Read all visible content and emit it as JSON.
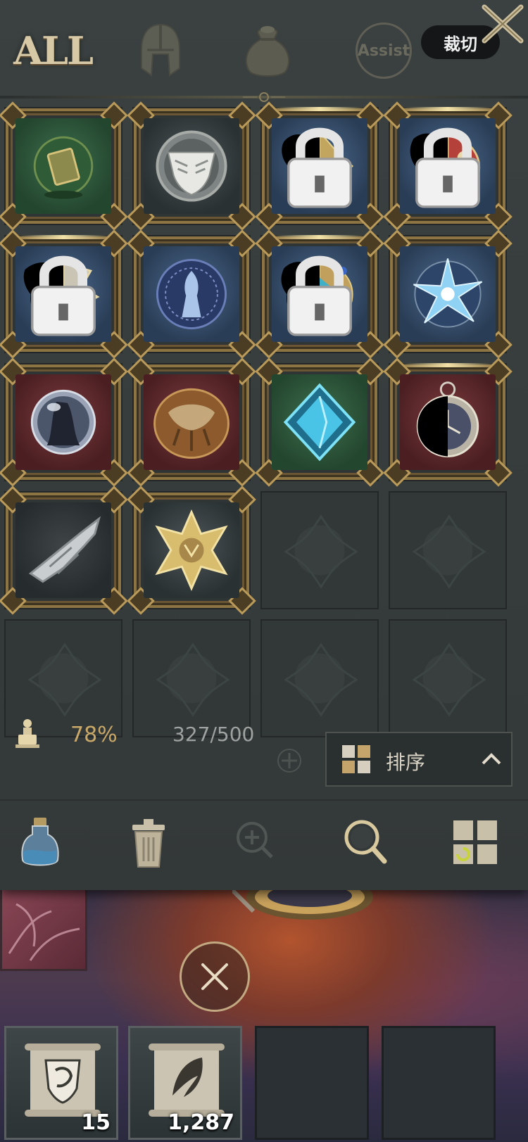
{
  "header": {
    "tabs": [
      {
        "label": "ALL",
        "icon": "text"
      },
      {
        "label": "",
        "icon": "helmet-icon"
      },
      {
        "label": "",
        "icon": "pouch-icon"
      },
      {
        "label": "Assist",
        "icon": "assist-ring-icon"
      }
    ],
    "crop_button": "裁切",
    "close_icon": "close-icon"
  },
  "inventory": {
    "slots": [
      {
        "item": "green-tome-orb",
        "background": "green",
        "locked": false,
        "highlight": false
      },
      {
        "item": "winged-crest-emblem",
        "background": "slate",
        "locked": false,
        "highlight": false
      },
      {
        "item": "gold-ornament-relic",
        "background": "blue",
        "locked": true,
        "highlight": true
      },
      {
        "item": "crimson-dragon-relic",
        "background": "blue",
        "locked": true,
        "highlight": true
      },
      {
        "item": "silver-wing-relic",
        "background": "blue",
        "locked": true,
        "highlight": true
      },
      {
        "item": "blue-spirit-sigil",
        "background": "blue",
        "locked": false,
        "highlight": false
      },
      {
        "item": "azure-gem-relic",
        "background": "blue",
        "locked": true,
        "highlight": true
      },
      {
        "item": "ice-star-shard",
        "background": "blue",
        "locked": false,
        "highlight": false
      },
      {
        "item": "crystal-ball",
        "background": "red",
        "locked": false,
        "highlight": false
      },
      {
        "item": "bronze-shell",
        "background": "red",
        "locked": false,
        "highlight": false
      },
      {
        "item": "cyan-diamond-crystal",
        "background": "green",
        "locked": false,
        "highlight": false
      },
      {
        "item": "pocket-watch",
        "background": "red",
        "locked": false,
        "highlight": true
      },
      {
        "item": "silver-gauntlet",
        "background": "dark",
        "locked": false,
        "highlight": false
      },
      {
        "item": "golden-star-emblem",
        "background": "slate",
        "locked": false,
        "highlight": false
      },
      {
        "item": "",
        "background": "empty"
      },
      {
        "item": "",
        "background": "empty"
      },
      {
        "item": "",
        "background": "empty"
      },
      {
        "item": "",
        "background": "empty"
      },
      {
        "item": "",
        "background": "empty"
      },
      {
        "item": "",
        "background": "empty"
      }
    ]
  },
  "status": {
    "weight_percent": "78%",
    "capacity": "327/500",
    "sort_label": "排序"
  },
  "toolbar": {
    "tools": [
      "potion-bottle-icon",
      "trash-can-icon",
      "magnify-plus-icon",
      "search-icon",
      "grid-refresh-icon"
    ]
  },
  "quickbar": {
    "slots": [
      {
        "item": "lion-crest-scroll",
        "count": "15"
      },
      {
        "item": "feather-scroll",
        "count": "1,287"
      },
      {
        "item": "",
        "count": ""
      },
      {
        "item": "",
        "count": ""
      }
    ]
  },
  "colors": {
    "panel": "#363c3c",
    "gold_frame": "#8d7443",
    "weight_text": "#c9a868",
    "capacity_text": "#9ea2a0"
  }
}
